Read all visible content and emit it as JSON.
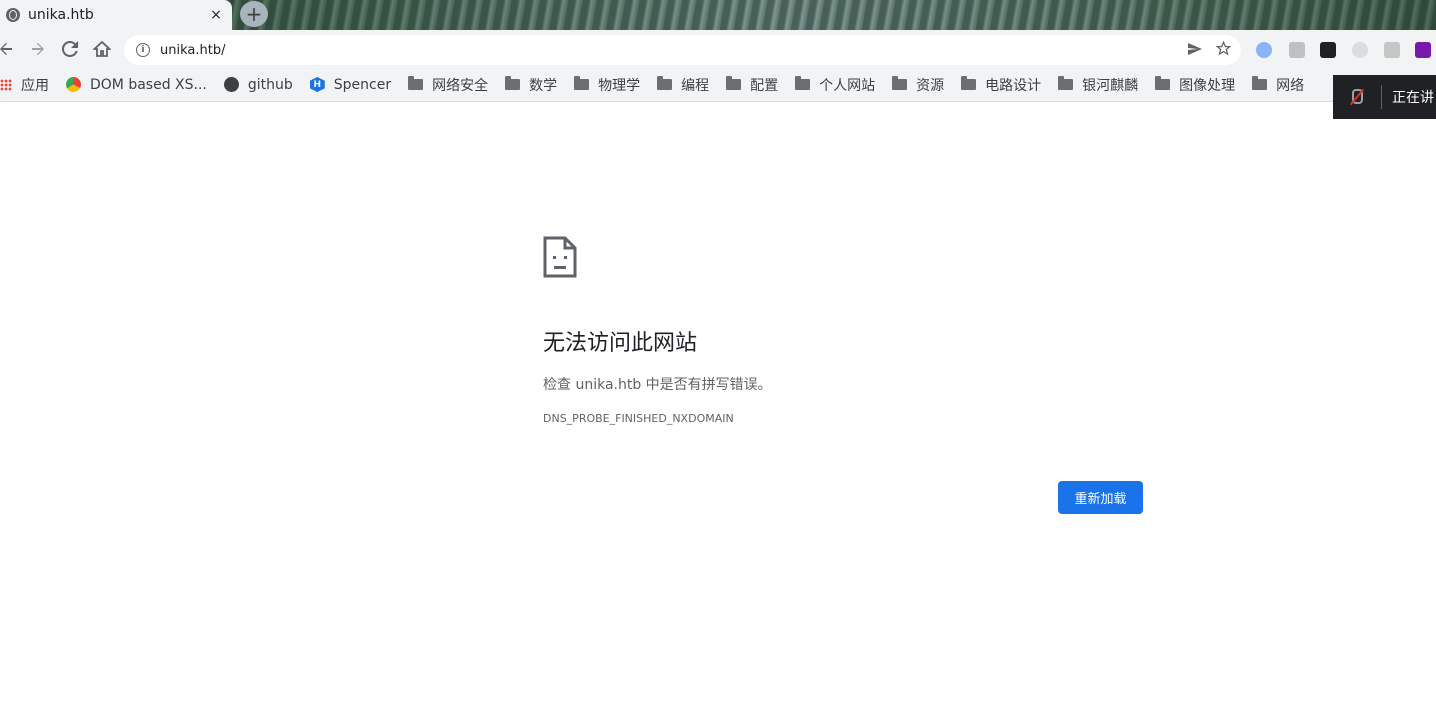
{
  "tab": {
    "title": "unika.htb",
    "close": "×",
    "new_tab": "+"
  },
  "toolbar": {
    "url": "unika.htb/"
  },
  "bookmarks": [
    {
      "label": "应用",
      "icon": "apps-icon"
    },
    {
      "label": "DOM based XS...",
      "icon": "bookmark-favicon-icon"
    },
    {
      "label": "github",
      "icon": "github-icon"
    },
    {
      "label": "Spencer",
      "icon": "hexagon-h-icon"
    },
    {
      "label": "网络安全",
      "icon": "folder-icon"
    },
    {
      "label": "数学",
      "icon": "folder-icon"
    },
    {
      "label": "物理学",
      "icon": "folder-icon"
    },
    {
      "label": "编程",
      "icon": "folder-icon"
    },
    {
      "label": "配置",
      "icon": "folder-icon"
    },
    {
      "label": "个人网站",
      "icon": "folder-icon"
    },
    {
      "label": "资源",
      "icon": "folder-icon"
    },
    {
      "label": "电路设计",
      "icon": "folder-icon"
    },
    {
      "label": "银河麒麟",
      "icon": "folder-icon"
    },
    {
      "label": "图像处理",
      "icon": "folder-icon"
    },
    {
      "label": "网络",
      "icon": "folder-icon"
    }
  ],
  "presenting": {
    "text": "正在讲"
  },
  "error": {
    "title": "无法访问此网站",
    "description": "检查 unika.htb 中是否有拼写错误。",
    "code": "DNS_PROBE_FINISHED_NXDOMAIN",
    "reload_label": "重新加载"
  },
  "colors": {
    "accent": "#1a73e8",
    "toolbar_bg": "#f1f3f4",
    "present_bg": "#202124"
  }
}
